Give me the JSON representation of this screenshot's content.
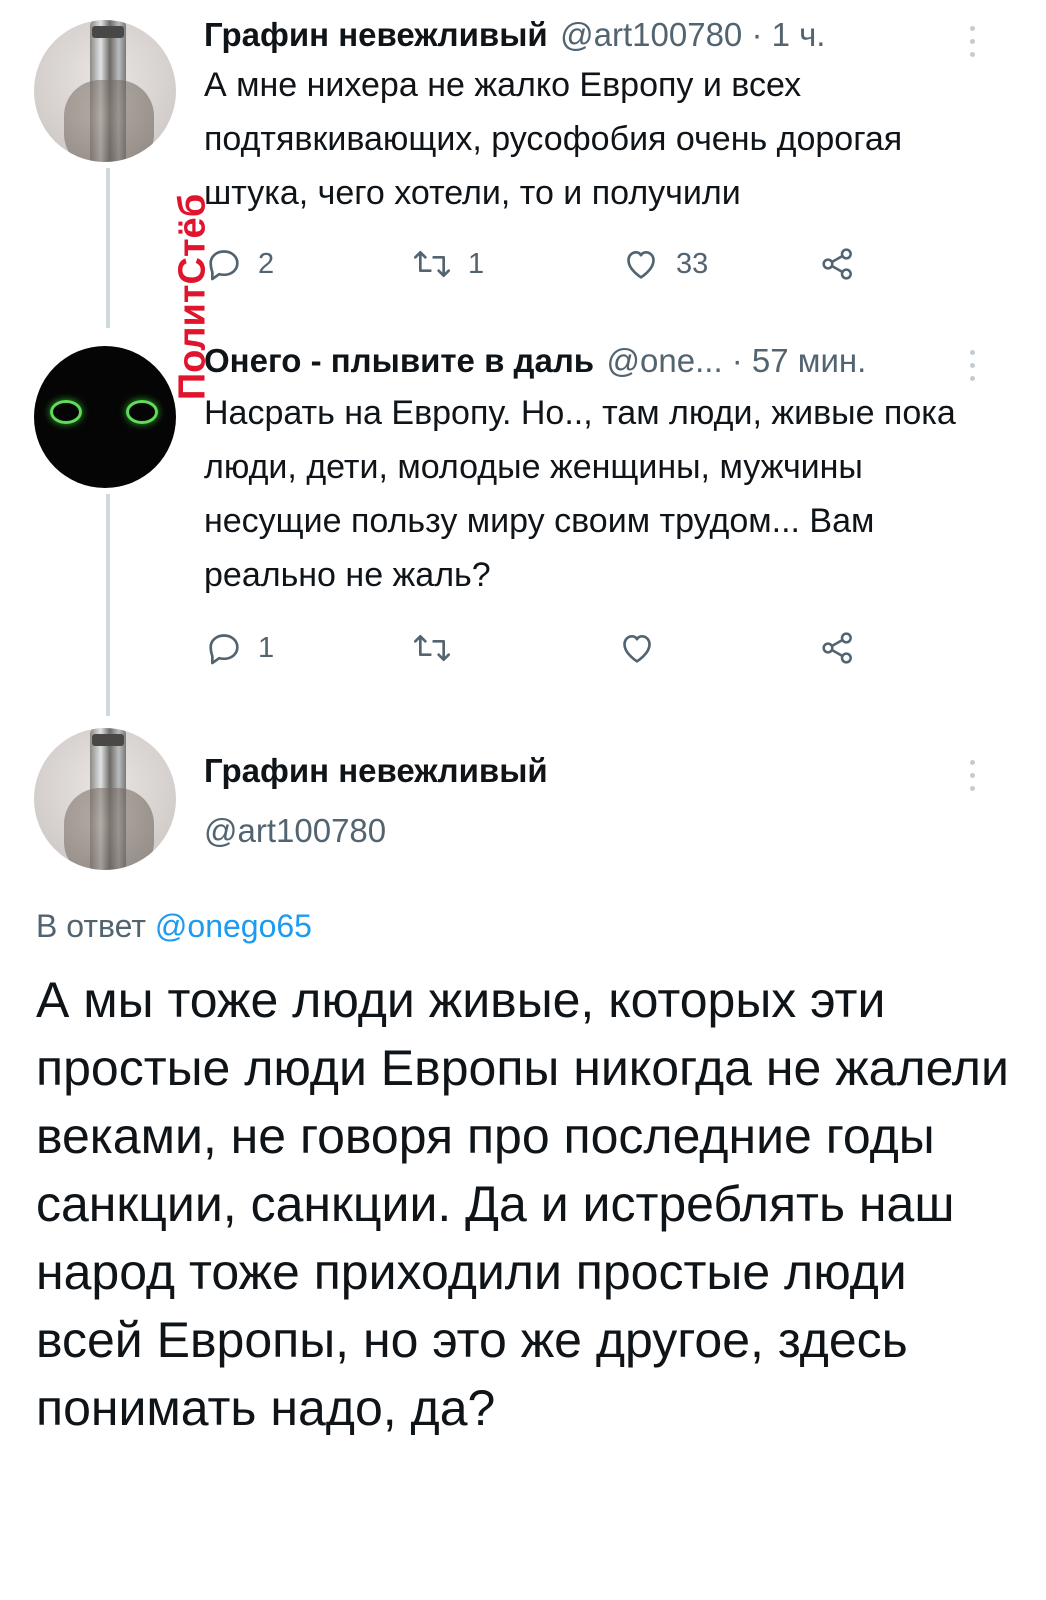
{
  "tweets": [
    {
      "author_name": "Графин невежливый",
      "meta": "@art100780 · 1 ч.",
      "text": "А мне нихера не жалко Европу и всех подтявкивающих, русофобия очень дорогая штука, чего хотели, то и получили",
      "actions": {
        "replies": "2",
        "retweets": "1",
        "likes": "33"
      }
    },
    {
      "author_name": "Онего - плывите в даль",
      "meta": "@one... · 57 мин.",
      "text": "Насрать на Европу. Но.., там люди, живые пока люди, дети, молодые женщины, мужчины несущие пользу миру своим трудом... Вам реально не жаль?",
      "actions": {
        "replies": "1",
        "retweets": "",
        "likes": ""
      }
    }
  ],
  "focused_tweet": {
    "author_name": "Графин невежливый",
    "handle": "@art100780",
    "reply_prefix": "В ответ",
    "reply_mention": "@onego65",
    "text": "А мы тоже люди живые, которых эти простые люди Европы никогда не жалели веками, не говоря про последние годы санкции, санкции. Да и истреблять наш народ тоже приходили простые люди всей Европы, но это же другое, здесь понимать надо, да?"
  },
  "watermark": "ПолитСтёб",
  "colors": {
    "text": "#0f1419",
    "secondary": "#536471",
    "link": "#1d9bf0",
    "thread_line": "#cfd9de",
    "watermark": "#e0142c"
  },
  "icons": [
    "reply-icon",
    "retweet-icon",
    "like-icon",
    "share-icon",
    "more-icon"
  ]
}
